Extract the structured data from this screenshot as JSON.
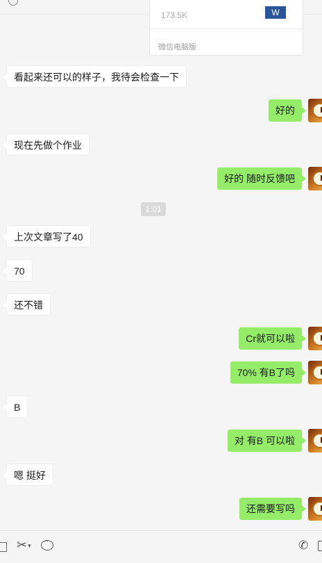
{
  "file_card": {
    "size": "173.5K",
    "icon_text": "W",
    "source": "微信电脑版"
  },
  "time_separator": "1:01",
  "messages": [
    {
      "side": "left",
      "text": "看起来还可以的样子，我待会检查一下"
    },
    {
      "side": "right",
      "text": "好的"
    },
    {
      "side": "left",
      "text": "现在先做个作业"
    },
    {
      "side": "right",
      "text": "好的 随时反馈吧"
    },
    {
      "side": "left",
      "text": "上次文章写了40"
    },
    {
      "side": "left",
      "text": "70"
    },
    {
      "side": "left",
      "text": "还不错"
    },
    {
      "side": "right",
      "text": "Cr就可以啦"
    },
    {
      "side": "right",
      "text": "70% 有B了吗"
    },
    {
      "side": "left",
      "text": "B"
    },
    {
      "side": "right",
      "text": "对 有B 可以啦"
    },
    {
      "side": "left",
      "text": "嗯 挺好"
    },
    {
      "side": "right",
      "text": "还需要写吗"
    }
  ],
  "toolbar": {
    "folder_icon": "folder-icon",
    "scissors_icon": "scissors-icon",
    "scissors_caret": "▾",
    "emoji_icon": "chat-history-icon",
    "phone_icon": "phone-icon",
    "video_icon": "video-icon"
  }
}
